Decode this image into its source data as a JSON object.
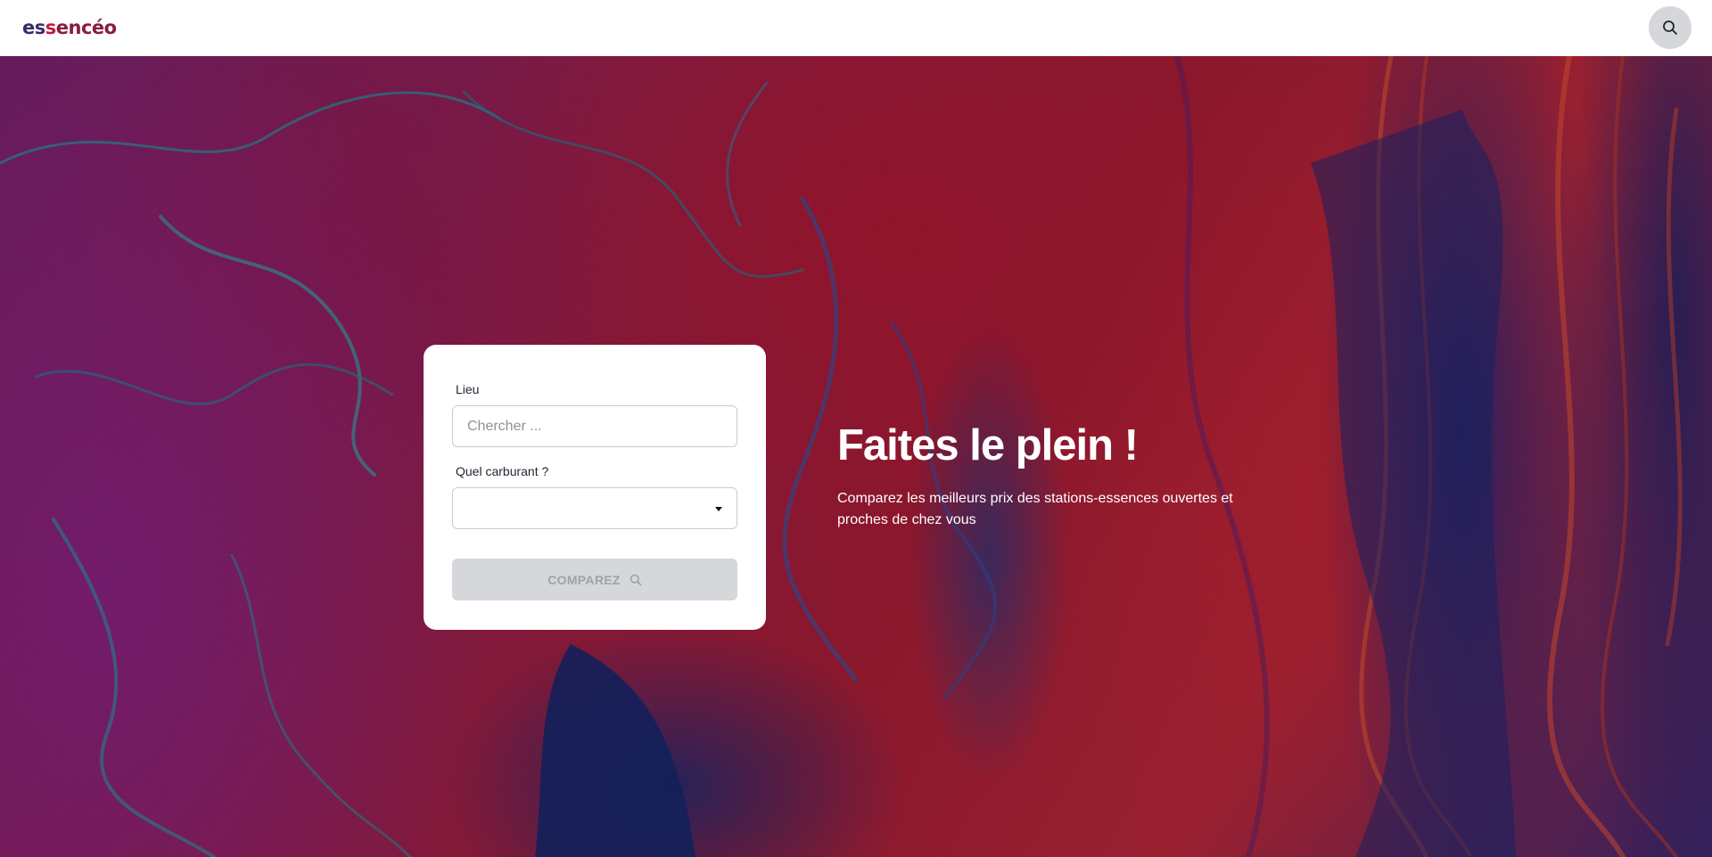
{
  "header": {
    "logo_part1": "es",
    "logo_part2": "s",
    "logo_part3": "encéo",
    "search_icon": "search-icon"
  },
  "form": {
    "location_label": "Lieu",
    "location_placeholder": "Chercher ...",
    "location_value": "",
    "fuel_label": "Quel carburant ?",
    "fuel_selected": "",
    "submit_label": "COMPAREZ",
    "submit_icon": "search-icon"
  },
  "hero": {
    "title": "Faites le plein !",
    "subtitle": "Comparez les meilleurs prix des stations-essences ouvertes et proches de chez vous"
  },
  "colors": {
    "brand_primary": "#8a1d3f",
    "brand_accent": "#c0183f",
    "brand_dark": "#3a2a6e",
    "button_disabled_bg": "#d6d7da",
    "button_disabled_text": "#9ea2a9"
  }
}
